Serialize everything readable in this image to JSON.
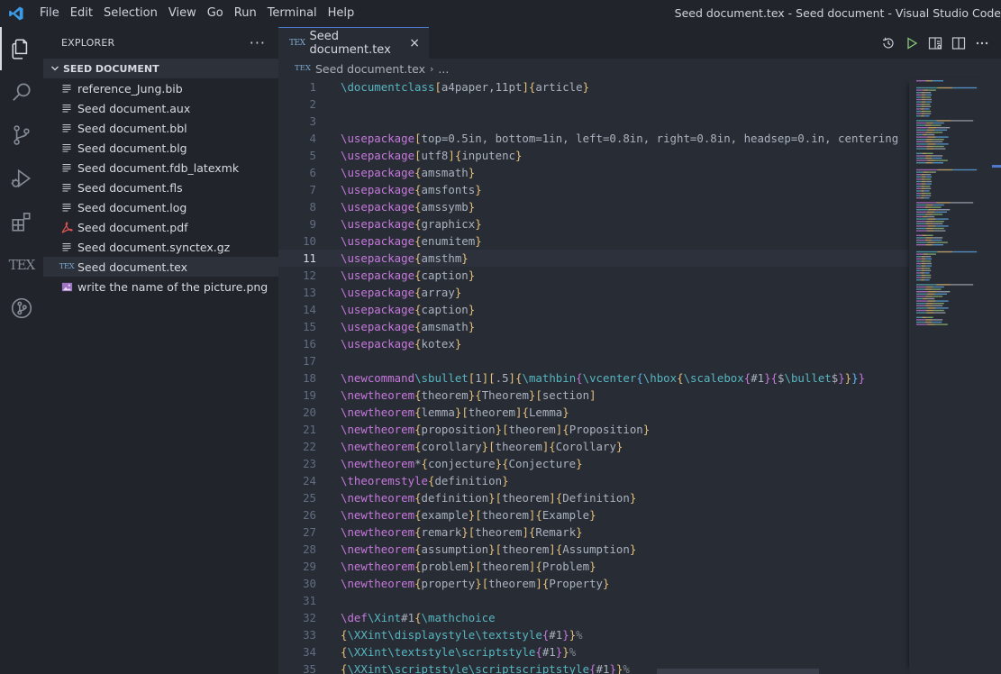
{
  "titlebar": {
    "menu": [
      "File",
      "Edit",
      "Selection",
      "View",
      "Go",
      "Run",
      "Terminal",
      "Help"
    ],
    "window_title": "Seed document.tex - Seed document - Visual Studio Code",
    "accent_color": "#4d78cc"
  },
  "activitybar": {
    "items": [
      "explorer-icon",
      "search-icon",
      "source-control-icon",
      "run-debug-icon",
      "extensions-icon",
      "tex-icon",
      "git-graph-icon"
    ],
    "tex_label": "TEX"
  },
  "sidebar": {
    "title": "EXPLORER",
    "more": "···",
    "folder": "SEED DOCUMENT",
    "files": [
      {
        "name": "reference_Jung.bib",
        "icon": "lines-icon"
      },
      {
        "name": "Seed document.aux",
        "icon": "lines-icon"
      },
      {
        "name": "Seed document.bbl",
        "icon": "lines-icon"
      },
      {
        "name": "Seed document.blg",
        "icon": "lines-icon"
      },
      {
        "name": "Seed document.fdb_latexmk",
        "icon": "lines-icon"
      },
      {
        "name": "Seed document.fls",
        "icon": "lines-icon"
      },
      {
        "name": "Seed document.log",
        "icon": "lines-icon"
      },
      {
        "name": "Seed document.pdf",
        "icon": "pdf-icon"
      },
      {
        "name": "Seed document.synctex.gz",
        "icon": "lines-icon"
      },
      {
        "name": "Seed document.tex",
        "icon": "tex-icon",
        "active": true
      },
      {
        "name": "write the name of the picture.png",
        "icon": "image-icon"
      }
    ],
    "tex_badge": "TEX"
  },
  "editor": {
    "tab_label": "Seed document.tex",
    "tab_close": "×",
    "tab_badge": "TEX",
    "breadcrumb": {
      "file": "Seed document.tex",
      "sep": "›",
      "more": "..."
    },
    "current_line": 11,
    "lines": [
      "\\documentclass[a4paper,11pt]{article}",
      "",
      "",
      "\\usepackage[top=0.5in, bottom=1in, left=0.8in, right=0.8in, headsep=0.in, centering",
      "\\usepackage[utf8]{inputenc}",
      "\\usepackage{amsmath}",
      "\\usepackage{amsfonts}",
      "\\usepackage{amssymb}",
      "\\usepackage{graphicx}",
      "\\usepackage{enumitem}",
      "\\usepackage{amsthm}",
      "\\usepackage{caption}",
      "\\usepackage{array}",
      "\\usepackage{caption}",
      "\\usepackage{amsmath}",
      "\\usepackage{kotex}",
      "",
      "\\newcommand\\sbullet[1][.5]{\\mathbin{\\vcenter{\\hbox{\\scalebox{#1}{$\\bullet$}}}}",
      "\\newtheorem{theorem}{Theorem}[section]",
      "\\newtheorem{lemma}[theorem]{Lemma}",
      "\\newtheorem{proposition}[theorem]{Proposition}",
      "\\newtheorem{corollary}[theorem]{Corollary}",
      "\\newtheorem*{conjecture}{Conjecture}",
      "\\theoremstyle{definition}",
      "\\newtheorem{definition}[theorem]{Definition}",
      "\\newtheorem{example}[theorem]{Example}",
      "\\newtheorem{remark}[theorem]{Remark}",
      "\\newtheorem{assumption}[theorem]{Assumption}",
      "\\newtheorem{problem}[theorem]{Problem}",
      "\\newtheorem{property}[theorem]{Property}",
      "",
      "\\def\\Xint#1{\\mathchoice",
      "{\\XXint\\displaystyle\\textstyle{#1}}%",
      "{\\XXint\\textstyle\\scriptstyle{#1}}%",
      "{\\XXint\\scriptstyle\\scriptscriptstyle{#1}}%"
    ]
  }
}
